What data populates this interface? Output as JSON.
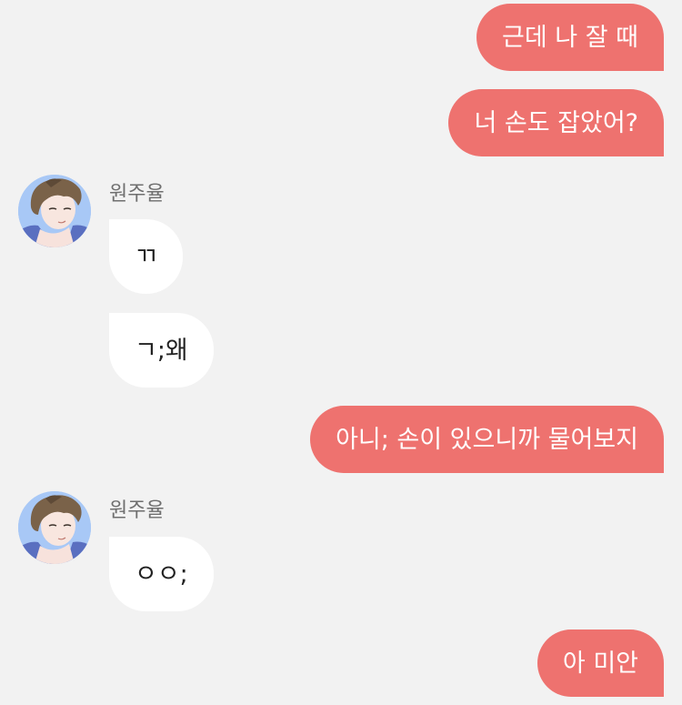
{
  "colors": {
    "background": "#f2f2f2",
    "outgoing_bubble": "#ee726f",
    "incoming_bubble": "#ffffff",
    "avatar_bg": "#a8c8f6"
  },
  "messages": [
    {
      "from": "me",
      "text": "근데 나 잘 때"
    },
    {
      "from": "me",
      "text": "너 손도 잡았어?"
    },
    {
      "from": "them",
      "sender": "원주율",
      "text": "ㄲ"
    },
    {
      "from": "them",
      "text": "ㄱ;왜"
    },
    {
      "from": "me",
      "text": "아니; 손이 있으니까 물어보지"
    },
    {
      "from": "them",
      "sender": "원주율",
      "text": "ㅇㅇ;"
    },
    {
      "from": "me",
      "text": "아 미안"
    }
  ],
  "contact": {
    "name": "원주율",
    "avatar_icon": "boy-portrait-avatar"
  }
}
